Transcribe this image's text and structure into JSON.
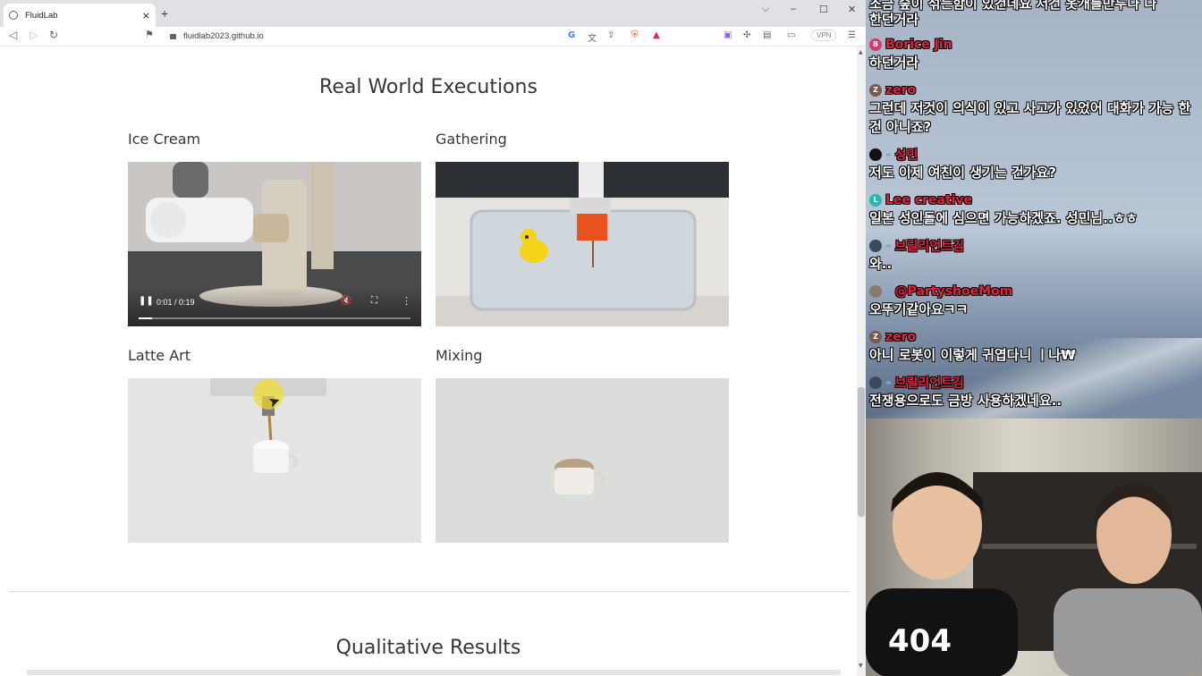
{
  "browser": {
    "tab_title": "FluidLab",
    "tab_close": "×",
    "new_tab": "+",
    "url": "fluidlab2023.github.io",
    "vpn": "VPN",
    "window_controls": [
      "⌵",
      "–",
      "☐",
      "✕"
    ]
  },
  "page": {
    "section_title": "Real World Executions",
    "next_section_title": "Qualitative Results",
    "videos": [
      {
        "label": "Ice Cream",
        "time": "0:01 / 0:19",
        "progress": 0.05
      },
      {
        "label": "Gathering"
      },
      {
        "label": "Latte Art"
      },
      {
        "label": "Mixing"
      }
    ]
  },
  "chat": {
    "messages": [
      {
        "user": "",
        "text": "조금 숲이 섞는함이 있건데요 저건 옷개를만두다 다"
      },
      {
        "user": "",
        "text": "한던거라"
      },
      {
        "user": "Borice Jin",
        "avatar_letter": "B",
        "avatar_color": "#d43a6a",
        "text": "하던거라"
      },
      {
        "user": "zero",
        "avatar_letter": "Z",
        "avatar_color": "#7a5a4a",
        "text": "그런데 저것이 의식이 있고 사고가 있었어 대화가 가능 한건 아니죠?"
      },
      {
        "user": "성민",
        "avatar_letter": "",
        "avatar_color": "#111111",
        "text": "저도 이제 여친이 생기는 건가요?"
      },
      {
        "user": "Lee creative",
        "avatar_letter": "L",
        "avatar_color": "#2bb5b0",
        "text": "일본 성인돌에 심으면 가능하겠죠. 성민님..ㅎㅎ"
      },
      {
        "user": "브릴리언트김",
        "avatar_letter": "",
        "avatar_color": "#3a4a5a",
        "text": "와.."
      },
      {
        "user": "@PartyshoeMom",
        "avatar_letter": "",
        "avatar_color": "#8a7a6a",
        "text": "오뚜기같아요ㅋㅋ"
      },
      {
        "user": "zero",
        "avatar_letter": "Z",
        "avatar_color": "#7a5a4a",
        "text": "아니 로봇이 이렇게 귀엽다니 ㅣ나₩"
      },
      {
        "user": "브릴리언트김",
        "avatar_letter": "",
        "avatar_color": "#3a4a5a",
        "text": "전쟁용으로도 금방 사용하겠네요.."
      }
    ]
  },
  "webcam": {
    "shirt_text": "404"
  }
}
